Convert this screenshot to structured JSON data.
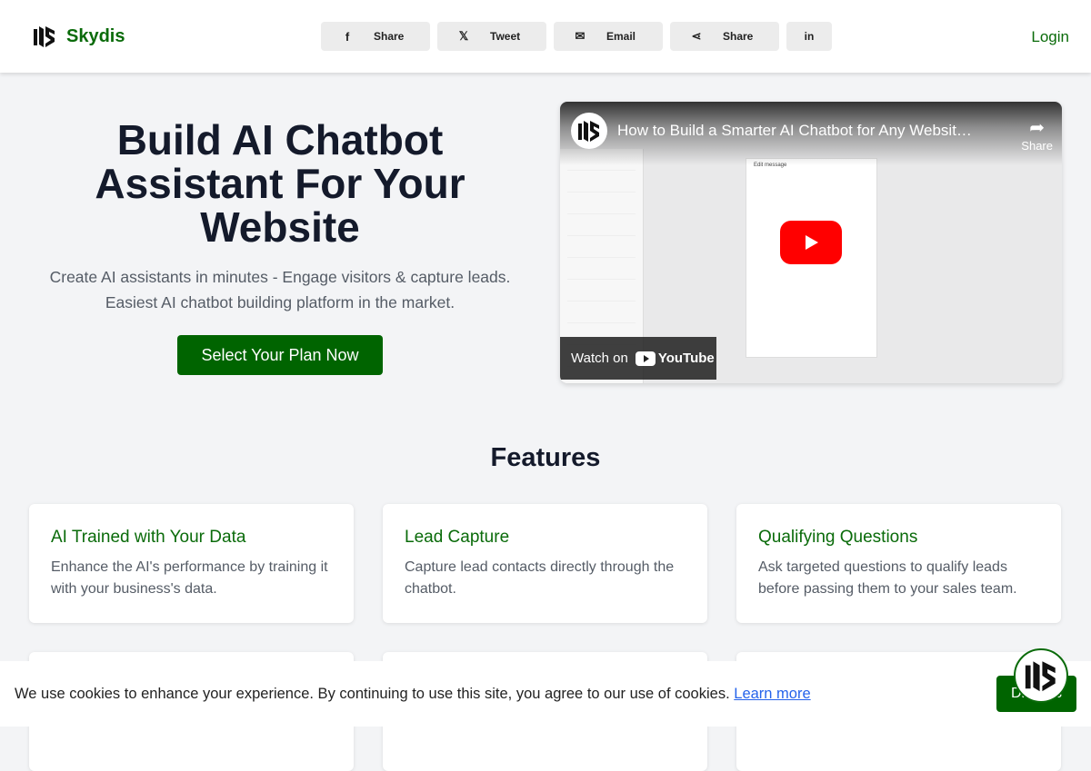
{
  "brand": {
    "name": "Skydis",
    "accent": "#006400"
  },
  "header": {
    "share_buttons": [
      {
        "icon": "facebook-icon",
        "label": "Share"
      },
      {
        "icon": "x-icon",
        "label": "Tweet"
      },
      {
        "icon": "email-icon",
        "label": "Email"
      },
      {
        "icon": "share-icon",
        "label": "Share"
      },
      {
        "icon": "linkedin-icon",
        "label": "in"
      }
    ],
    "login": "Login"
  },
  "hero": {
    "title_lines": [
      "Build AI Chatbot",
      "Assistant For Your",
      "Website"
    ],
    "subtitle_lines": [
      "Create AI assistants in minutes - Engage visitors & capture leads.",
      "Easiest AI chatbot building platform in the market."
    ],
    "cta": "Select Your Plan Now"
  },
  "video": {
    "title": "How to Build a Smarter AI Chatbot for Any Websit…",
    "share": "Share",
    "watch_on": "Watch on",
    "youtube": "YouTube",
    "modal_title": "Edit message"
  },
  "features": {
    "heading": "Features",
    "items": [
      {
        "title": "AI Trained with Your Data",
        "desc": "Enhance the AI's performance by training it with your business's data."
      },
      {
        "title": "Lead Capture",
        "desc": "Capture lead contacts directly through the chatbot."
      },
      {
        "title": "Qualifying Questions",
        "desc": "Ask targeted questions to qualify leads before passing them to your sales team."
      }
    ]
  },
  "cookie": {
    "text": "We use cookies to enhance your experience. By continuing to use this site, you agree to our use of cookies.",
    "link": "Learn more",
    "button": "Dismiss"
  }
}
